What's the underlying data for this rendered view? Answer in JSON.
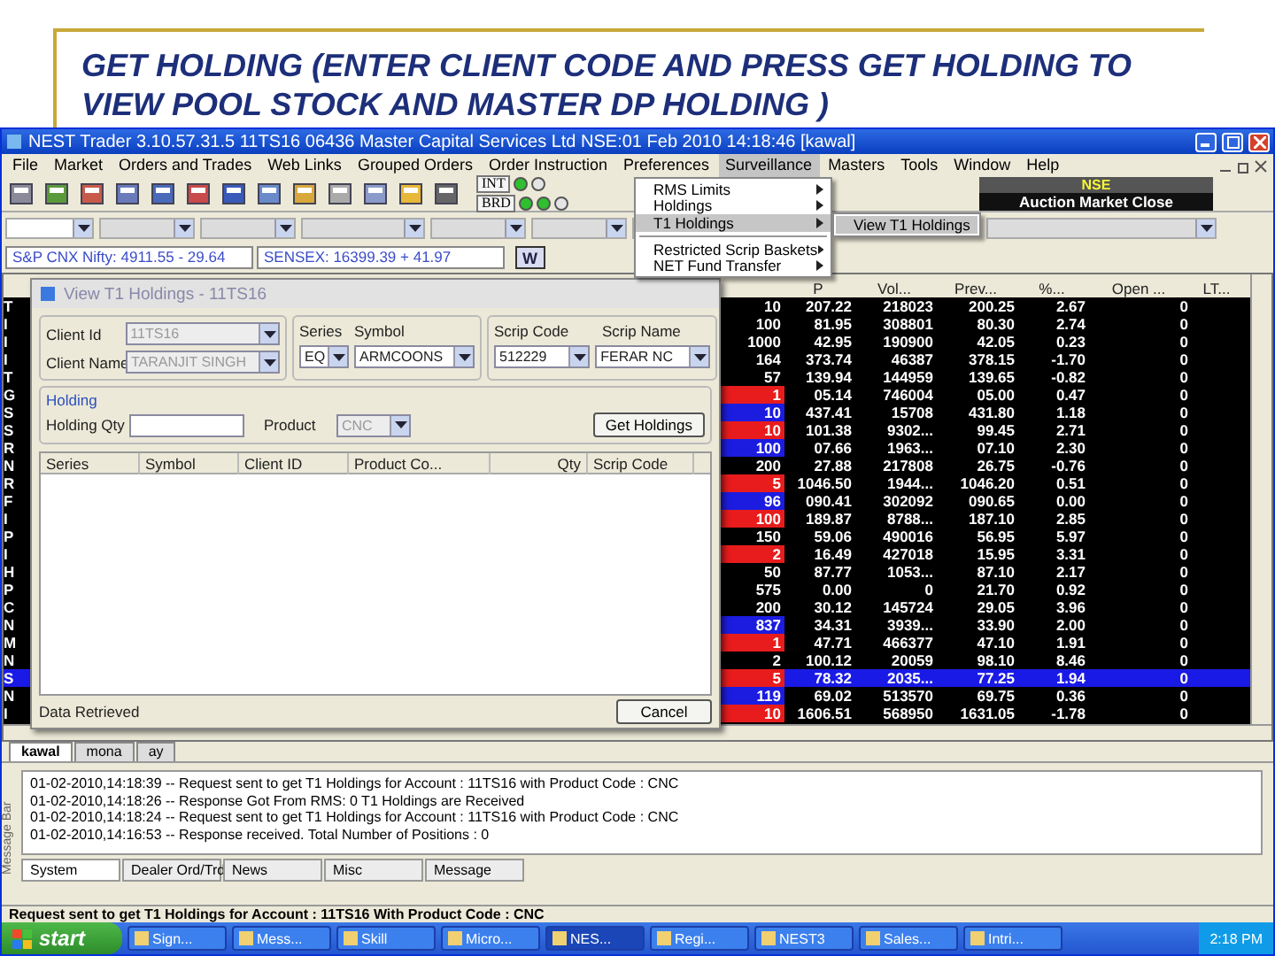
{
  "slide": {
    "title": "GET HOLDING (ENTER CLIENT CODE AND PRESS GET HOLDING TO VIEW POOL STOCK AND MASTER DP HOLDING )"
  },
  "window": {
    "title": "NEST Trader 3.10.57.31.5 11TS16 06436 Master Capital Services Ltd NSE:01 Feb 2010 14:18:46  [kawal]",
    "menu": [
      {
        "label": "File",
        "selected": false
      },
      {
        "label": "Market",
        "selected": false
      },
      {
        "label": "Orders and Trades",
        "selected": false
      },
      {
        "label": "Web Links",
        "selected": false
      },
      {
        "label": "Grouped Orders",
        "selected": false
      },
      {
        "label": "Order Instruction",
        "selected": false
      },
      {
        "label": "Preferences",
        "selected": false
      },
      {
        "label": "Surveillance",
        "selected": true
      },
      {
        "label": "Masters",
        "selected": false
      },
      {
        "label": "Tools",
        "selected": false
      },
      {
        "label": "Window",
        "selected": false
      },
      {
        "label": "Help",
        "selected": false
      }
    ]
  },
  "surveillance_menu": {
    "sections": [
      [
        {
          "label": "RMS Limits",
          "selected": false
        },
        {
          "label": "Holdings",
          "selected": false
        },
        {
          "label": "T1 Holdings",
          "selected": true
        }
      ],
      [
        {
          "label": "Restricted Scrip Baskets",
          "selected": false
        },
        {
          "label": "NET Fund Transfer",
          "selected": false
        }
      ]
    ],
    "submenu": [
      {
        "label": "View T1 Holdings",
        "selected": true
      }
    ]
  },
  "toolbar": {
    "indicators": [
      {
        "label": "INT",
        "lights": [
          true,
          false
        ]
      },
      {
        "label": "BRD",
        "lights": [
          true,
          true,
          false
        ]
      }
    ],
    "exchange": "NSE",
    "market_status": "Auction Market Close"
  },
  "index_bar": {
    "indices": [
      "S&P CNX Nifty: 4911.55 - 29.64",
      "SENSEX: 16399.39 + 41.97"
    ],
    "button": "W"
  },
  "market_watch": {
    "columns": [
      "P",
      "Vol...",
      "Prev...",
      "%...",
      "Open ...",
      "LT..."
    ],
    "rows": [
      {
        "symbol": "T",
        "qty": "10",
        "price": "207.22",
        "volume": "218023",
        "prev": "200.25",
        "change": "2.67",
        "open": "0",
        "selected": false
      },
      {
        "symbol": "I",
        "qty": "100",
        "price": "81.95",
        "volume": "308801",
        "prev": "80.30",
        "change": "2.74",
        "open": "0",
        "selected": false
      },
      {
        "symbol": "I",
        "qty": "1000",
        "price": "42.95",
        "volume": "190900",
        "prev": "42.05",
        "change": "0.23",
        "open": "0",
        "selected": false
      },
      {
        "symbol": "I",
        "qty": "164",
        "price": "373.74",
        "volume": "46387",
        "prev": "378.15",
        "change": "-1.70",
        "open": "0",
        "selected": false
      },
      {
        "symbol": "T",
        "qty": "57",
        "price": "139.94",
        "volume": "144959",
        "prev": "139.65",
        "change": "-0.82",
        "open": "0",
        "selected": false
      },
      {
        "symbol": "G",
        "qty": "1",
        "color": "#e81c1c",
        "price": "05.14",
        "volume": "746004",
        "prev": "05.00",
        "change": "0.47",
        "open": "0",
        "selected": false
      },
      {
        "symbol": "S",
        "qty": "10",
        "color": "#1c1ce0",
        "price": "437.41",
        "volume": "15708",
        "prev": "431.80",
        "change": "1.18",
        "open": "0",
        "selected": false
      },
      {
        "symbol": "S",
        "qty": "10",
        "color": "#e81c1c",
        "price": "101.38",
        "volume": "9302...",
        "prev": "99.45",
        "change": "2.71",
        "open": "0",
        "selected": false
      },
      {
        "symbol": "R",
        "qty": "100",
        "color": "#1c1ce0",
        "price": "07.66",
        "volume": "1963...",
        "prev": "07.10",
        "change": "2.30",
        "open": "0",
        "selected": false
      },
      {
        "symbol": "N",
        "qty": "200",
        "price": "27.88",
        "volume": "217808",
        "prev": "26.75",
        "change": "-0.76",
        "open": "0",
        "selected": false
      },
      {
        "symbol": "R",
        "qty": "5",
        "color": "#e81c1c",
        "price": "1046.50",
        "volume": "1944...",
        "prev": "1046.20",
        "change": "0.51",
        "open": "0",
        "selected": false
      },
      {
        "symbol": "F",
        "qty": "96",
        "color": "#1c1ce0",
        "price": "090.41",
        "volume": "302092",
        "prev": "090.65",
        "change": "0.00",
        "open": "0",
        "selected": false
      },
      {
        "symbol": "I",
        "qty": "100",
        "color": "#e81c1c",
        "price": "189.87",
        "volume": "8788...",
        "prev": "187.10",
        "change": "2.85",
        "open": "0",
        "selected": false
      },
      {
        "symbol": "P",
        "qty": "150",
        "price": "59.06",
        "volume": "490016",
        "prev": "56.95",
        "change": "5.97",
        "open": "0",
        "selected": false
      },
      {
        "symbol": "I",
        "qty": "2",
        "color": "#e81c1c",
        "price": "16.49",
        "volume": "427018",
        "prev": "15.95",
        "change": "3.31",
        "open": "0",
        "selected": false
      },
      {
        "symbol": "H",
        "qty": "50",
        "price": "87.77",
        "volume": "1053...",
        "prev": "87.10",
        "change": "2.17",
        "open": "0",
        "selected": false
      },
      {
        "symbol": "P",
        "qty": "575",
        "price": "0.00",
        "volume": "0",
        "prev": "21.70",
        "change": "0.92",
        "open": "0",
        "selected": false
      },
      {
        "symbol": "C",
        "qty": "200",
        "price": "30.12",
        "volume": "145724",
        "prev": "29.05",
        "change": "3.96",
        "open": "0",
        "selected": false
      },
      {
        "symbol": "N",
        "qty": "837",
        "color": "#1c1ce0",
        "price": "34.31",
        "volume": "3939...",
        "prev": "33.90",
        "change": "2.00",
        "open": "0",
        "selected": false
      },
      {
        "symbol": "M",
        "qty": "1",
        "color": "#e81c1c",
        "price": "47.71",
        "volume": "466377",
        "prev": "47.10",
        "change": "1.91",
        "open": "0",
        "selected": false
      },
      {
        "symbol": "N",
        "qty": "2",
        "price": "100.12",
        "volume": "20059",
        "prev": "98.10",
        "change": "8.46",
        "open": "0",
        "selected": false
      },
      {
        "symbol": "S",
        "qty": "5",
        "color": "#e81c1c",
        "price": "78.32",
        "volume": "2035...",
        "prev": "77.25",
        "change": "1.94",
        "open": "0",
        "selected": true
      },
      {
        "symbol": "N",
        "qty": "119",
        "color": "#1c1ce0",
        "price": "69.02",
        "volume": "513570",
        "prev": "69.75",
        "change": "0.36",
        "open": "0",
        "selected": false
      },
      {
        "symbol": "I",
        "qty": "10",
        "color": "#e81c1c",
        "price": "1606.51",
        "volume": "568950",
        "prev": "1631.05",
        "change": "-1.78",
        "open": "0",
        "selected": false
      }
    ]
  },
  "dialog": {
    "title": "View T1 Holdings - 11TS16",
    "client_id_label": "Client Id",
    "client_id": "11TS16",
    "client_name_label": "Client Name",
    "client_name": "TARANJIT SINGH",
    "series_label": "Series",
    "series": "EQ",
    "symbol_label": "Symbol",
    "symbol": "ARMCOONS",
    "scrip_code_label": "Scrip Code",
    "scrip_code": "512229",
    "scrip_name_label": "Scrip Name",
    "scrip_name": "FERAR NC",
    "holding_group": "Holding",
    "holding_qty_label": "Holding Qty",
    "product_label": "Product",
    "product": "CNC",
    "get_button": "Get Holdings",
    "columns": [
      "Series",
      "Symbol",
      "Client ID",
      "Product Co...",
      "Qty",
      "Scrip Code"
    ],
    "status": "Data Retrieved",
    "cancel_button": "Cancel"
  },
  "sheet_tabs": [
    {
      "label": "kawal",
      "selected": true
    },
    {
      "label": "mona",
      "selected": false
    },
    {
      "label": "ay",
      "selected": false
    }
  ],
  "message_log": {
    "side_label": "Message Bar",
    "lines": [
      "01-02-2010,14:18:39 -- Request sent to get T1 Holdings for Account : 11TS16 with Product Code : CNC",
      "01-02-2010,14:18:26 -- Response Got From RMS: 0 T1 Holdings are Received",
      "01-02-2010,14:18:24 -- Request sent to get T1 Holdings for Account : 11TS16 with Product Code : CNC",
      "01-02-2010,14:16:53 -- Response received. Total Number of Positions : 0"
    ],
    "tabs": [
      {
        "label": "System",
        "selected": true
      },
      {
        "label": "Dealer Ord/Trd",
        "selected": false
      },
      {
        "label": "News",
        "selected": false
      },
      {
        "label": "Misc",
        "selected": false
      },
      {
        "label": "Message",
        "selected": false
      }
    ]
  },
  "status_bar": "Request sent to get T1 Holdings for Account : 11TS16 With Product Code : CNC",
  "taskbar": {
    "start": "start",
    "items": [
      {
        "label": "Sign...",
        "selected": false
      },
      {
        "label": "Mess...",
        "selected": false
      },
      {
        "label": "Skill",
        "selected": false
      },
      {
        "label": "Micro...",
        "selected": false
      },
      {
        "label": "NES...",
        "selected": true
      },
      {
        "label": "Regi...",
        "selected": false
      },
      {
        "label": "NEST3",
        "selected": false
      },
      {
        "label": "Sales...",
        "selected": false
      },
      {
        "label": "Intri...",
        "selected": false
      }
    ],
    "clock": "2:18 PM"
  }
}
